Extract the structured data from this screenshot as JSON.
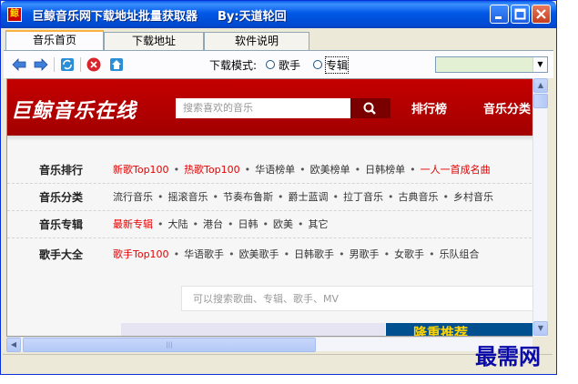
{
  "window": {
    "title": "巨鲸音乐网下载地址批量获取器",
    "author": "By:天道轮回",
    "icon_glyph": "鲸"
  },
  "tabs": [
    {
      "label": "音乐首页",
      "active": true
    },
    {
      "label": "下载地址",
      "active": false
    },
    {
      "label": "软件说明",
      "active": false
    }
  ],
  "toolbar": {
    "icons": [
      "back-icon",
      "forward-icon",
      "refresh-icon",
      "stop-icon",
      "home-icon"
    ],
    "mode_label": "下载模式:",
    "radio_options": [
      {
        "label": "歌手",
        "selected": false
      },
      {
        "label": "专辑",
        "selected": false
      }
    ],
    "combo_value": ""
  },
  "site": {
    "logo": "巨鲸音乐在线",
    "search_placeholder": "搜索喜欢的音乐",
    "nav": [
      "排行榜",
      "音乐分类"
    ],
    "categories": [
      {
        "label": "音乐排行",
        "links": [
          {
            "text": "新歌Top100",
            "red": true
          },
          {
            "text": "热歌Top100",
            "red": true
          },
          {
            "text": "华语榜单",
            "red": false
          },
          {
            "text": "欧美榜单",
            "red": false
          },
          {
            "text": "日韩榜单",
            "red": false
          },
          {
            "text": "一人一首成名曲",
            "red": true
          }
        ]
      },
      {
        "label": "音乐分类",
        "links": [
          {
            "text": "流行音乐",
            "red": false
          },
          {
            "text": "摇滚音乐",
            "red": false
          },
          {
            "text": "节奏布鲁斯",
            "red": false
          },
          {
            "text": "爵士蓝调",
            "red": false
          },
          {
            "text": "拉丁音乐",
            "red": false
          },
          {
            "text": "古典音乐",
            "red": false
          },
          {
            "text": "乡村音乐",
            "red": false
          }
        ]
      },
      {
        "label": "音乐专辑",
        "links": [
          {
            "text": "最新专辑",
            "red": true
          },
          {
            "text": "大陆",
            "red": false
          },
          {
            "text": "港台",
            "red": false
          },
          {
            "text": "日韩",
            "red": false
          },
          {
            "text": "欧美",
            "red": false
          },
          {
            "text": "其它",
            "red": false
          }
        ]
      },
      {
        "label": "歌手大全",
        "links": [
          {
            "text": "歌手Top100",
            "red": true
          },
          {
            "text": "华语歌手",
            "red": false
          },
          {
            "text": "欧美歌手",
            "red": false
          },
          {
            "text": "日韩歌手",
            "red": false
          },
          {
            "text": "男歌手",
            "red": false
          },
          {
            "text": "女歌手",
            "red": false
          },
          {
            "text": "乐队组合",
            "red": false
          }
        ]
      }
    ],
    "mv_search_placeholder": "可以搜索歌曲、专辑、歌手、MV",
    "banner_text": "隆重推荐"
  },
  "watermark": "最需网",
  "colors": {
    "title_bar": "#0058e6",
    "site_red": "#c40000",
    "link_red": "#e40000",
    "tab_highlight": "#f9b142"
  }
}
